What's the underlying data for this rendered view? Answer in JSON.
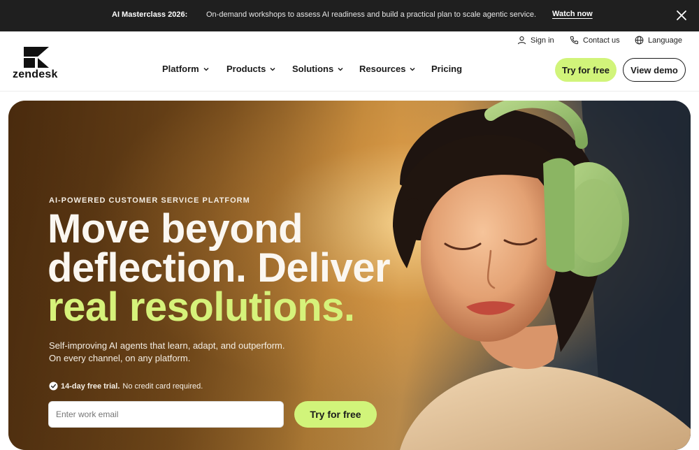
{
  "announcement": {
    "title": "AI Masterclass 2026:",
    "message": "On-demand workshops to assess AI readiness and build a practical plan to scale agentic service.",
    "link": "Watch now",
    "close_icon": "close-icon"
  },
  "header": {
    "logo_text": "zendesk",
    "utility": {
      "sign_in": "Sign in",
      "contact": "Contact us",
      "language": "Language"
    },
    "nav": {
      "platform": "Platform",
      "products": "Products",
      "solutions": "Solutions",
      "resources": "Resources",
      "pricing": "Pricing"
    },
    "cta": {
      "try": "Try for free",
      "demo": "View demo"
    }
  },
  "hero": {
    "eyebrow": "AI-POWERED CUSTOMER SERVICE PLATFORM",
    "headline_1": "Move beyond",
    "headline_2": "deflection. Deliver",
    "headline_3": "real resolutions.",
    "sub_1": "Self-improving AI agents that learn, adapt, and outperform.",
    "sub_2": "On every channel, on any platform.",
    "trial_bold": "14-day free trial.",
    "trial_rest": "No credit card required.",
    "email_placeholder": "Enter work email",
    "try_button": "Try for free"
  },
  "colors": {
    "accent_lime": "#d1f47a",
    "headline_highlight": "#d6f27a",
    "announce_bg": "#1f1f1f"
  }
}
